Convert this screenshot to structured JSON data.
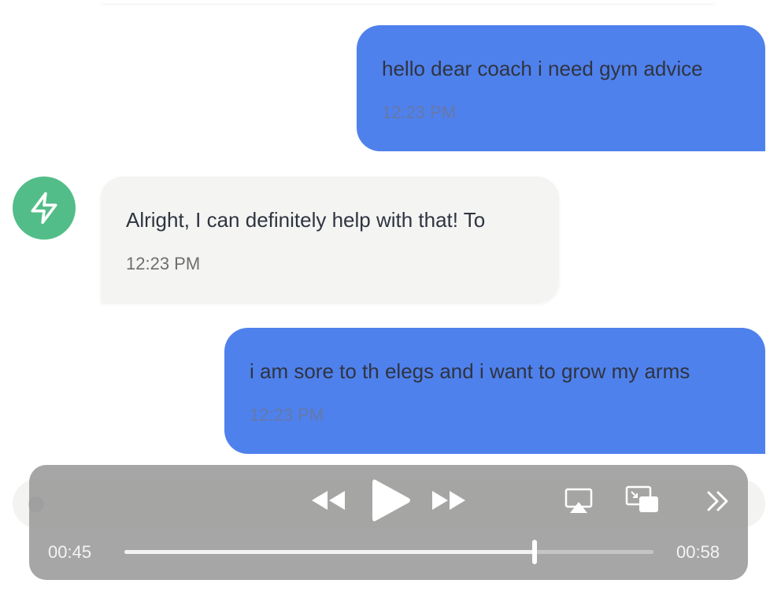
{
  "conversation": {
    "messages": [
      {
        "role": "user",
        "text": "hello dear coach i need gym advice",
        "time": "12:23 PM"
      },
      {
        "role": "bot",
        "text": "Alright, I can definitely help with that! To",
        "time": "12:23 PM"
      },
      {
        "role": "user",
        "text": "i am sore to th elegs and i want to grow my arms",
        "time": "12:23 PM"
      }
    ],
    "bot_avatar": {
      "icon": "lightning-bolt-icon",
      "color": "#52bd88"
    }
  },
  "player": {
    "elapsed": "00:45",
    "total": "00:58",
    "progress": 0.776,
    "controls": [
      "rewind-icon",
      "play-icon",
      "fast-forward-icon",
      "airplay-icon",
      "picture-in-picture-icon",
      "skip-forward-icon"
    ]
  },
  "colors": {
    "user_bubble": "#4f81ed",
    "bot_bubble": "#f4f4f3",
    "avatar": "#52bd88"
  }
}
